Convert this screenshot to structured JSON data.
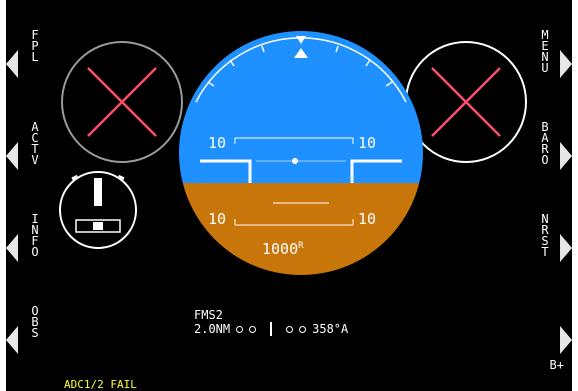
{
  "softkeys_left": [
    {
      "label": "FPL"
    },
    {
      "label": "ACTV"
    },
    {
      "label": "INFO"
    },
    {
      "label": "OBS"
    }
  ],
  "softkeys_right": [
    {
      "label": "MENU"
    },
    {
      "label": "BARO"
    },
    {
      "label": "NRST"
    }
  ],
  "attitude": {
    "pitch_upper_left": "10",
    "pitch_upper_right": "10",
    "pitch_lower_left": "10",
    "pitch_lower_right": "10",
    "radar_altitude": "1000",
    "radar_altitude_suffix": "R",
    "sky_color": "#1e90ff",
    "ground_color": "#c8760a"
  },
  "nav": {
    "source": "FMS2",
    "distance": "2.0NM",
    "course": "358°A"
  },
  "alert": {
    "text": "ADC1/2 FAIL",
    "color": "#ffff33"
  },
  "failed_indicator_color": "#ff4d6a",
  "extra_button": {
    "label": "B+"
  }
}
